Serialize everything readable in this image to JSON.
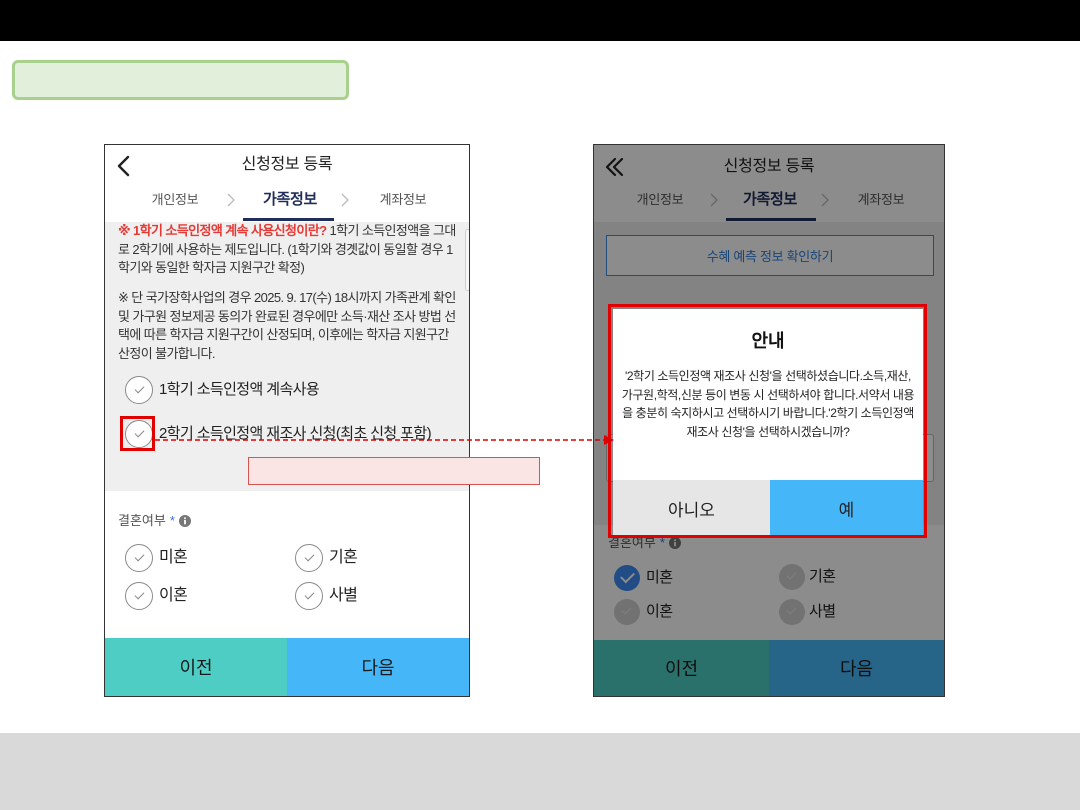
{
  "colors": {
    "prev_button": "#4ecdc4",
    "next_button": "#45b6f7",
    "tab_active": "#1f2d5a",
    "notice_highlight": "#e53935",
    "annotation_red": "#e00000",
    "callout_fill": "#fbe4e4",
    "label_box_fill": "#e2efda",
    "label_box_border": "#a9d18e",
    "radio_checked": "#3d8bf2",
    "predict_button": "#2c7fd9"
  },
  "icons": {
    "back": "chevron-left-icon",
    "back_double": "double-chevron-left-icon",
    "tab_separator": "chevron-right-icon",
    "info": "info-icon",
    "radio_check": "check-icon",
    "annotation_arrow": "dashed-arrow-icon"
  },
  "left_screen": {
    "header": {
      "title": "신청정보 등록"
    },
    "active_tab_index": 1,
    "tabs": [
      {
        "label": "개인정보"
      },
      {
        "label": "가족정보"
      },
      {
        "label": "계좌정보"
      }
    ],
    "notice": {
      "paragraph1_highlight": "※ 1학기 소득인정액 계속 사용신청이란?",
      "paragraph1_body": " 1학기 소득인정액을 그대로 2학기에 사용하는 제도입니다. (1학기와 경곗값이 동일할 경우 1학기와 동일한 학자금 지원구간 확정)",
      "paragraph2": "※ 단 국가장학사업의 경우 2025. 9. 17(수) 18시까지 가족관계 확인 및 가구원 정보제공 동의가 완료된 경우에만 소득·재산 조사 방법 선택에 따른 학자금 지원구간이 산정되며, 이후에는 학자금 지원구간 산정이 불가합니다."
    },
    "income_options": [
      {
        "label": "1학기 소득인정액 계속사용"
      },
      {
        "label": "2학기 소득인정액 재조사 신청(최초 신청 포함)"
      }
    ],
    "marriage": {
      "label": "결혼여부",
      "required_mark": "*",
      "options": [
        {
          "label": "미혼"
        },
        {
          "label": "기혼"
        },
        {
          "label": "이혼"
        },
        {
          "label": "사별"
        }
      ]
    },
    "buttons": {
      "prev": "이전",
      "next": "다음"
    }
  },
  "right_screen": {
    "header": {
      "title": "신청정보 등록"
    },
    "active_tab_index": 1,
    "tabs": [
      {
        "label": "개인정보"
      },
      {
        "label": "가족정보"
      },
      {
        "label": "계좌정보"
      }
    ],
    "predict_button": "수혜 예측 정보 확인하기",
    "marriage": {
      "label": "결혼여부",
      "required_mark": "*",
      "selected_index": 0,
      "options": [
        {
          "label": "미혼"
        },
        {
          "label": "기혼"
        },
        {
          "label": "이혼"
        },
        {
          "label": "사별"
        }
      ]
    },
    "buttons": {
      "prev": "이전",
      "next": "다음"
    },
    "dialog": {
      "title": "안내",
      "message": "'2학기 소득인정액 재조사 신청'을 선택하셨습니다.소득,재산,가구원,학적,신분 등이 변동 시 선택하셔야 합니다.서약서 내용을 충분히 숙지하시고 선택하시기 바랍니다.'2학기 소득인정액 재조사 신청'을 선택하시겠습니까?",
      "cancel": "아니오",
      "confirm": "예"
    }
  }
}
